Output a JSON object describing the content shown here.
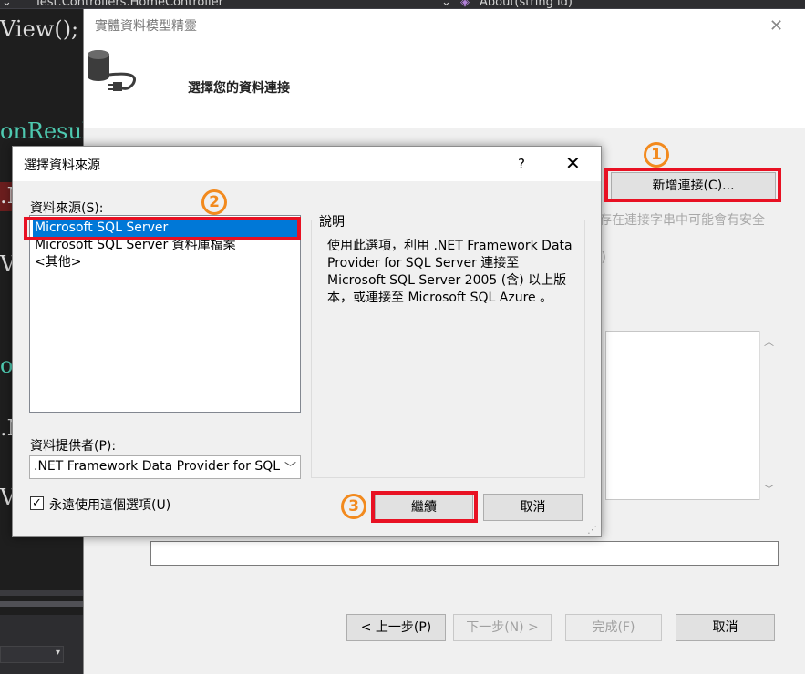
{
  "ide": {
    "tab1": "Test.Controllers.HomeController",
    "tab2": "About(string id)",
    "code_lines": [
      "View();",
      "onResul",
      ".M",
      "Vi",
      "on",
      ".M",
      "Vi"
    ]
  },
  "wizard": {
    "title": "實體資料模型精靈",
    "subtitle": "選擇您的資料連接",
    "new_connection_button": "新增連接(C)...",
    "hint_text": "存在連接字串中可能會有安全",
    "hint_text2": "’)",
    "buttons": {
      "previous": "< 上一步(P)",
      "next": "下一步(N) >",
      "finish": "完成(F)",
      "cancel": "取消"
    }
  },
  "dialog": {
    "title": "選擇資料來源",
    "help": "?",
    "close": "✕",
    "source_label": "資料來源(S):",
    "sources": [
      {
        "label": "Microsoft SQL Server",
        "selected": true
      },
      {
        "label": "Microsoft SQL Server 資料庫檔案",
        "selected": false
      },
      {
        "label": "<其他>",
        "selected": false
      }
    ],
    "description_legend": "說明",
    "description": "使用此選項，利用 .NET Framework Data Provider for SQL Server 連接至 Microsoft SQL Server 2005 (含) 以上版本，或連接至 Microsoft SQL Azure 。",
    "provider_label": "資料提供者(P):",
    "provider_value": ".NET Framework Data Provider for SQL",
    "always_use_label": "永遠使用這個選項(U)",
    "always_use_checked": true,
    "continue_button": "繼續",
    "cancel_button": "取消"
  },
  "annotations": {
    "step1": "1",
    "step2": "2",
    "step3": "3",
    "highlight_color": "#e81123",
    "marker_color": "#f28a1e"
  },
  "colors": {
    "selection": "#0078d7",
    "ide_background": "#1e1e1e",
    "ide_teal": "#4ec9b0"
  }
}
